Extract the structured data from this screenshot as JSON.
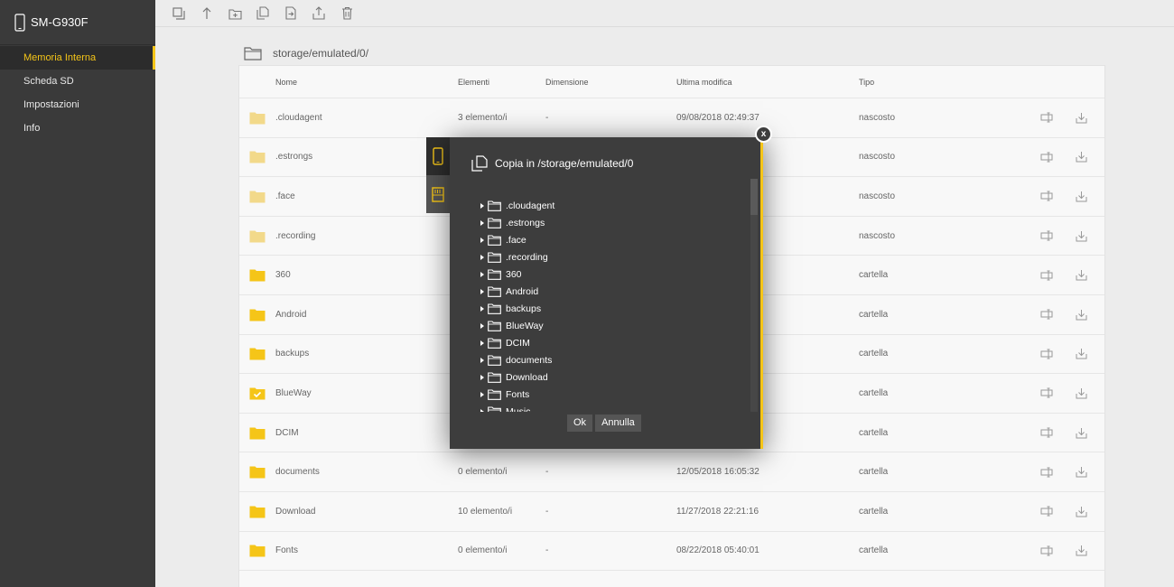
{
  "device": {
    "name": "SM-G930F",
    "icon": "phone-icon"
  },
  "sidebar": {
    "items": [
      {
        "label": "Memoria Interna",
        "active": true
      },
      {
        "label": "Scheda SD",
        "active": false
      },
      {
        "label": "Impostazioni",
        "active": false
      },
      {
        "label": "Info",
        "active": false
      }
    ]
  },
  "toolbar": {
    "buttons": [
      "select-all-icon",
      "up-arrow-icon",
      "new-folder-icon",
      "copy-icon",
      "move-icon",
      "upload-icon",
      "trash-icon"
    ]
  },
  "path": {
    "text": "storage/emulated/0/"
  },
  "table": {
    "headers": {
      "name": "Nome",
      "elements": "Elementi",
      "size": "Dimensione",
      "modified": "Ultima modifica",
      "type": "Tipo"
    },
    "rows": [
      {
        "name": ".cloudagent",
        "elements": "3 elemento/i",
        "size": "-",
        "modified": "09/08/2018 02:49:37",
        "type": "nascosto",
        "hidden": true
      },
      {
        "name": ".estrongs",
        "elements": "",
        "size": "",
        "modified": "",
        "type": "nascosto",
        "hidden": true
      },
      {
        "name": ".face",
        "elements": "",
        "size": "",
        "modified": "",
        "type": "nascosto",
        "hidden": true
      },
      {
        "name": ".recording",
        "elements": "",
        "size": "",
        "modified": "",
        "type": "nascosto",
        "hidden": true
      },
      {
        "name": "360",
        "elements": "",
        "size": "",
        "modified": "",
        "type": "cartella"
      },
      {
        "name": "Android",
        "elements": "",
        "size": "",
        "modified": "",
        "type": "cartella"
      },
      {
        "name": "backups",
        "elements": "",
        "size": "",
        "modified": "",
        "type": "cartella"
      },
      {
        "name": "BlueWay",
        "elements": "",
        "size": "",
        "modified": "",
        "type": "cartella",
        "checked": true
      },
      {
        "name": "DCIM",
        "elements": "",
        "size": "",
        "modified": "",
        "type": "cartella"
      },
      {
        "name": "documents",
        "elements": "0 elemento/i",
        "size": "-",
        "modified": "12/05/2018 16:05:32",
        "type": "cartella"
      },
      {
        "name": "Download",
        "elements": "10 elemento/i",
        "size": "-",
        "modified": "11/27/2018 22:21:16",
        "type": "cartella"
      },
      {
        "name": "Fonts",
        "elements": "0 elemento/i",
        "size": "-",
        "modified": "08/22/2018 05:40:01",
        "type": "cartella"
      },
      {
        "name": "",
        "elements": "",
        "size": "",
        "modified": "",
        "type": ""
      }
    ]
  },
  "dialog": {
    "title": "Copia in /storage/emulated/0",
    "close_label": "x",
    "folders": [
      ".cloudagent",
      ".estrongs",
      ".face",
      ".recording",
      "360",
      "Android",
      "backups",
      "BlueWay",
      "DCIM",
      "documents",
      "Download",
      "Fonts",
      "Music"
    ],
    "ok_label": "Ok",
    "cancel_label": "Annulla"
  },
  "colors": {
    "accent": "#f5c518",
    "sidebar_bg": "#3a3a3a",
    "dialog_bg": "#3d3d3d"
  }
}
